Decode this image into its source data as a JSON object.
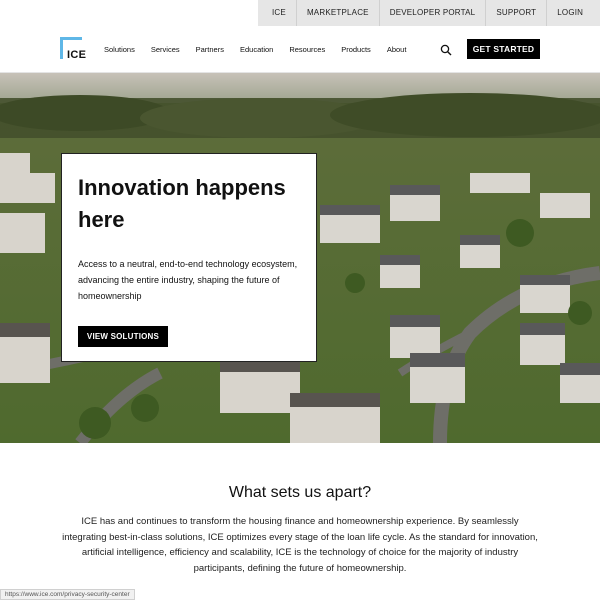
{
  "utility_nav": [
    "ICE",
    "MARKETPLACE",
    "DEVELOPER PORTAL",
    "SUPPORT",
    "LOGIN"
  ],
  "logo": {
    "text": "ICE",
    "accent_color": "#5fb7e7"
  },
  "main_nav": {
    "items": [
      "Solutions",
      "Services",
      "Partners",
      "Education",
      "Resources",
      "Products",
      "About"
    ],
    "search_icon": "search-icon",
    "cta_label": "GET STARTED"
  },
  "hero": {
    "title": "Innovation happens here",
    "text": "Access to a neutral, end-to-end technology ecosystem, advancing the entire industry, shaping the future of homeownership",
    "button_label": "VIEW SOLUTIONS"
  },
  "apart": {
    "title": "What sets us apart?",
    "text": "ICE has and continues to transform the housing finance and homeownership experience. By seamlessly integrating best-in-class solutions, ICE optimizes every stage of the loan life cycle. As the standard for innovation, artificial intelligence, efficiency and scalability, ICE is the technology of choice for the majority of industry participants, defining the future of homeownership."
  },
  "status_url": "https://www.ice.com/privacy-security-center"
}
